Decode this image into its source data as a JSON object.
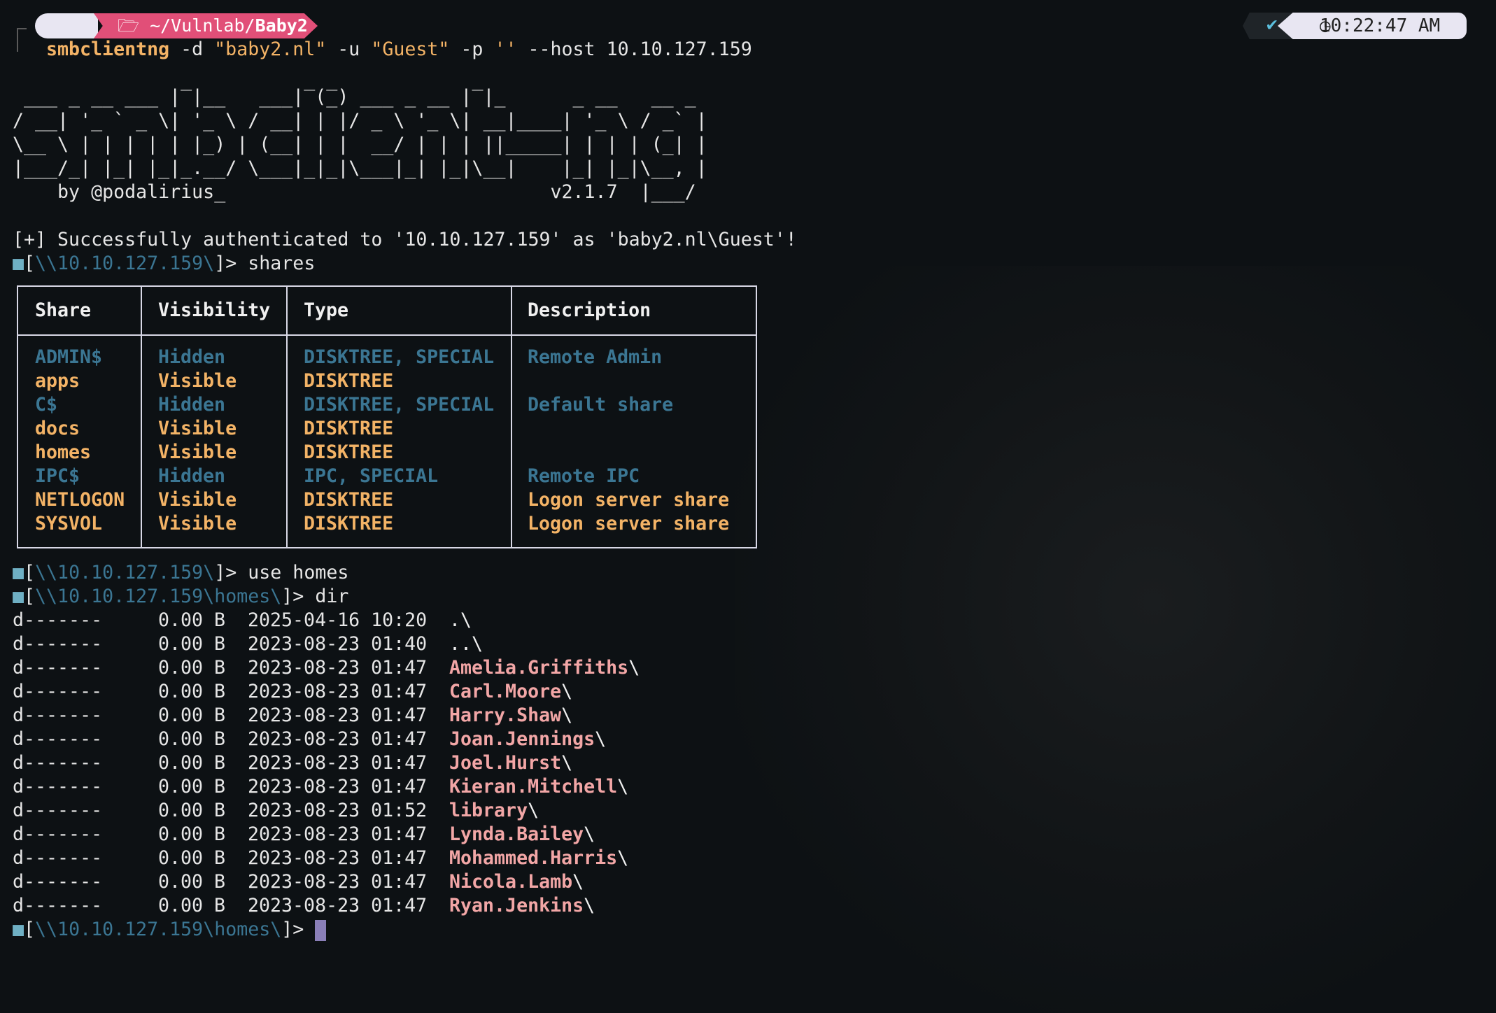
{
  "prompt": {
    "apple_glyph": "",
    "folder_glyph": "🗁",
    "path_prefix": "~/Vulnlab/",
    "path_bold": "Baby2",
    "check_glyph": "✔",
    "time": "10:22:47 AM",
    "clock_glyph": "◷"
  },
  "command": {
    "name": "smbclientng",
    "args_1": " -d ",
    "domain": "\"baby2.nl\"",
    "args_2": " -u ",
    "user": "\"Guest\"",
    "args_3": " -p ",
    "password": "''",
    "args_4": " --host 10.10.127.159"
  },
  "banner": {
    "lines": [
      "               _          _ _            _",
      " ___ _ __ ___ | |__   ___| (_) ___ _ __ | |_      _ __   __ _",
      "/ __| '_ ` _ \\| '_ \\ / __| | |/ _ \\ '_ \\| __|____| '_ \\ / _` |",
      "\\__ \\ | | | | | |_) | (__| | |  __/ | | | ||_____| | | | (_| |",
      "|___/_| |_| |_|_.__/ \\___|_|_|\\___|_| |_|\\__|    |_| |_|\\__, |",
      "    by @podalirius_                             v2.1.7  |___/"
    ]
  },
  "auth_message": "[+] Successfully authenticated to '10.10.127.159' as 'baby2.nl\\Guest'!",
  "prompts": {
    "square": "■",
    "open": "[",
    "close": "]> ",
    "root_path": "\\\\10.10.127.159\\",
    "homes_path": "\\\\10.10.127.159\\homes\\",
    "cmd_shares": "shares",
    "cmd_use": "use homes",
    "cmd_dir": "dir"
  },
  "shares_table": {
    "headers": [
      "Share",
      "Visibility",
      "Type",
      "Description"
    ],
    "rows": [
      {
        "share": "ADMIN$",
        "visibility": "Hidden",
        "type": "DISKTREE, SPECIAL",
        "description": "Remote Admin",
        "hidden": true
      },
      {
        "share": "apps",
        "visibility": "Visible",
        "type": "DISKTREE",
        "description": "",
        "hidden": false
      },
      {
        "share": "C$",
        "visibility": "Hidden",
        "type": "DISKTREE, SPECIAL",
        "description": "Default share",
        "hidden": true
      },
      {
        "share": "docs",
        "visibility": "Visible",
        "type": "DISKTREE",
        "description": "",
        "hidden": false
      },
      {
        "share": "homes",
        "visibility": "Visible",
        "type": "DISKTREE",
        "description": "",
        "hidden": false
      },
      {
        "share": "IPC$",
        "visibility": "Hidden",
        "type": "IPC, SPECIAL",
        "description": "Remote IPC",
        "hidden": true
      },
      {
        "share": "NETLOGON",
        "visibility": "Visible",
        "type": "DISKTREE",
        "description": "Logon server share",
        "hidden": false
      },
      {
        "share": "SYSVOL",
        "visibility": "Visible",
        "type": "DISKTREE",
        "description": "Logon server share",
        "hidden": false
      }
    ]
  },
  "dir_listing": [
    {
      "attrs": "d-------",
      "size": "0.00 B",
      "date": "2025-04-16 10:20",
      "name": ".\\",
      "plain": true
    },
    {
      "attrs": "d-------",
      "size": "0.00 B",
      "date": "2023-08-23 01:40",
      "name": "..\\",
      "plain": true
    },
    {
      "attrs": "d-------",
      "size": "0.00 B",
      "date": "2023-08-23 01:47",
      "name": "Amelia.Griffiths",
      "plain": false
    },
    {
      "attrs": "d-------",
      "size": "0.00 B",
      "date": "2023-08-23 01:47",
      "name": "Carl.Moore",
      "plain": false
    },
    {
      "attrs": "d-------",
      "size": "0.00 B",
      "date": "2023-08-23 01:47",
      "name": "Harry.Shaw",
      "plain": false
    },
    {
      "attrs": "d-------",
      "size": "0.00 B",
      "date": "2023-08-23 01:47",
      "name": "Joan.Jennings",
      "plain": false
    },
    {
      "attrs": "d-------",
      "size": "0.00 B",
      "date": "2023-08-23 01:47",
      "name": "Joel.Hurst",
      "plain": false
    },
    {
      "attrs": "d-------",
      "size": "0.00 B",
      "date": "2023-08-23 01:47",
      "name": "Kieran.Mitchell",
      "plain": false
    },
    {
      "attrs": "d-------",
      "size": "0.00 B",
      "date": "2023-08-23 01:52",
      "name": "library",
      "plain": false
    },
    {
      "attrs": "d-------",
      "size": "0.00 B",
      "date": "2023-08-23 01:47",
      "name": "Lynda.Bailey",
      "plain": false
    },
    {
      "attrs": "d-------",
      "size": "0.00 B",
      "date": "2023-08-23 01:47",
      "name": "Mohammed.Harris",
      "plain": false
    },
    {
      "attrs": "d-------",
      "size": "0.00 B",
      "date": "2023-08-23 01:47",
      "name": "Nicola.Lamb",
      "plain": false
    },
    {
      "attrs": "d-------",
      "size": "0.00 B",
      "date": "2023-08-23 01:47",
      "name": "Ryan.Jenkins",
      "plain": false
    }
  ],
  "dir_suffix": "\\",
  "colors": {
    "background": "#0d1114",
    "accent_yellow": "#f3b366",
    "hidden_blue": "#3b7693",
    "dir_pink": "#f2a6a6",
    "prompt_pink": "#e14f78"
  }
}
